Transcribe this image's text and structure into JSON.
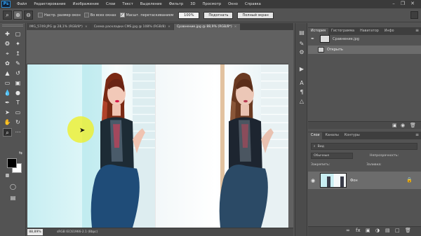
{
  "app": {
    "logo": "Ps"
  },
  "menu": [
    "Файл",
    "Редактирование",
    "Изображение",
    "Слои",
    "Текст",
    "Выделение",
    "Фильтр",
    "3D",
    "Просмотр",
    "Окно",
    "Справка"
  ],
  "window_controls": {
    "minimize": "–",
    "restore": "❐",
    "close": "✕"
  },
  "options_bar": {
    "resize_windows": "Настр. размер окон",
    "all_windows": "Во всех окнах",
    "scrubby_zoom": "Масшт. перетаскиванием",
    "zoom_value": "100%",
    "fit_screen": "Подогнать",
    "fill_screen": "Полный экран"
  },
  "doc_tabs": [
    {
      "label": "IMG_5749.JPG @ 28,1% (RGB/8*)",
      "close": "×"
    },
    {
      "label": "Схема раскладки CMS.jpg @ 108% (RGB/8)",
      "close": "×"
    },
    {
      "label": "Сравнение.jpg @ 88,9% (RGB/8*)",
      "close": "×"
    }
  ],
  "status_bar": {
    "zoom": "88,89%",
    "doc_info": "sRGB IEC61966-2.1 (8bpc)"
  },
  "history_panel": {
    "tabs": [
      "История",
      "Гистограмма",
      "Навигатор",
      "Инфо"
    ],
    "snapshot": "Сравнение.jpg",
    "step": "Открыть"
  },
  "layers_panel": {
    "tabs": [
      "Слои",
      "Каналы",
      "Контуры"
    ],
    "search": "Вид",
    "blend_mode": "Обычные",
    "opacity_label": "Непрозрачность:",
    "lock_label": "Закрепить:",
    "fill_label": "Заливка:",
    "layer_name": "Фон"
  }
}
